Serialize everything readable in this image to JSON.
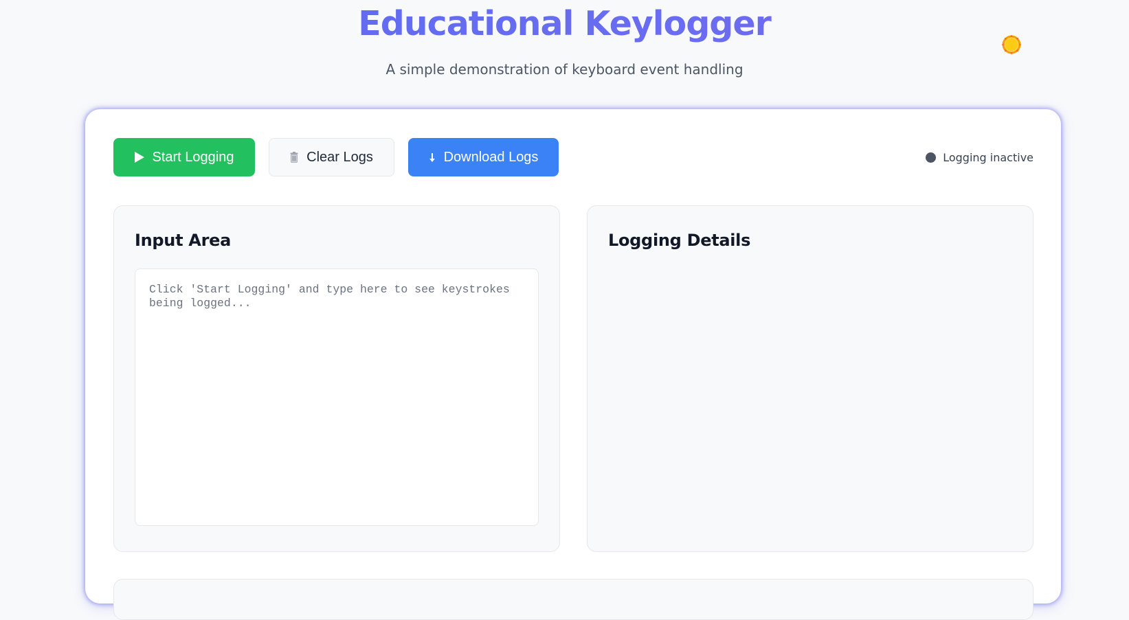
{
  "header": {
    "title": "Educational Keylogger",
    "subtitle": "A simple demonstration of keyboard event handling",
    "theme_toggle_icon": "sun-icon"
  },
  "toolbar": {
    "start_label": "Start Logging",
    "start_icon": "play-icon",
    "clear_label": "Clear Logs",
    "clear_icon": "trash-icon",
    "download_label": "Download Logs",
    "download_icon": "download-arrow-icon"
  },
  "status": {
    "text": "Logging inactive"
  },
  "input_panel": {
    "title": "Input Area",
    "placeholder": "Click 'Start Logging' and type here to see keystrokes being logged...",
    "value": ""
  },
  "details_panel": {
    "title": "Logging Details"
  },
  "colors": {
    "title_gradient_start": "#5a6df0",
    "title_gradient_end": "#7b68ee",
    "start_button": "#22c05e",
    "download_button": "#3b82f6",
    "status_dot_inactive": "#4b5563",
    "sun": "#facc15"
  }
}
